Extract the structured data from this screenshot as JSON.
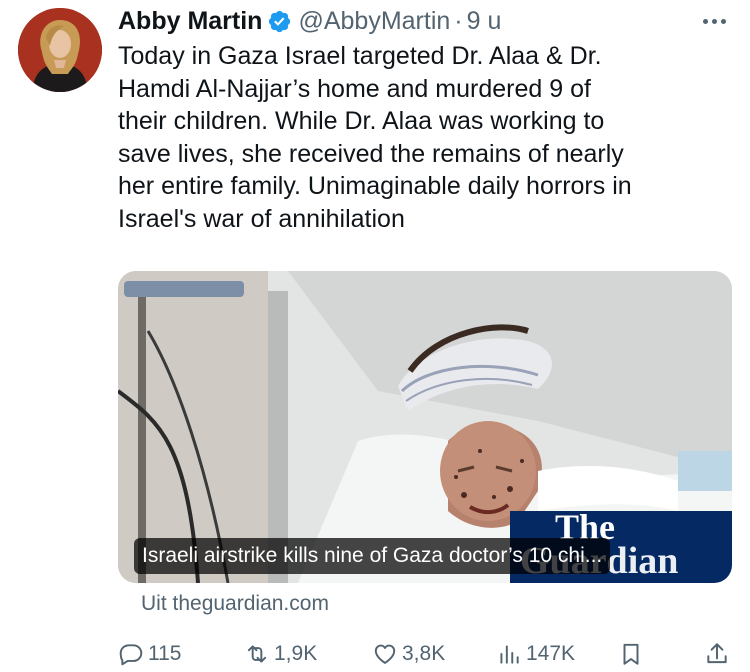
{
  "author": {
    "display_name": "Abby Martin",
    "handle": "@AbbyMartin",
    "separator": "·",
    "time": "9 u",
    "verified": true
  },
  "tweet": {
    "text": "Today in Gaza Israel targeted Dr. Alaa & Dr.\nHamdi Al-Najjar’s home and murdered 9 of\ntheir children. While Dr. Alaa was working to\nsave lives, she received the remains of nearly\nher entire family. Unimaginable daily horrors in\nIsrael's war of annihilation"
  },
  "link_card": {
    "title": "Israeli airstrike kills nine of Gaza doctor’s 10 chi...",
    "logo_line1": "The",
    "logo_line2": "Guardian",
    "source": "Uit theguardian.com"
  },
  "actions": {
    "replies": "115",
    "reposts": "1,9K",
    "likes": "3,8K",
    "views": "147K"
  },
  "icons": {
    "reply": "reply-icon",
    "repost": "repost-icon",
    "like": "heart-icon",
    "views": "views-icon",
    "bookmark": "bookmark-icon",
    "share": "share-icon",
    "more": "more-icon",
    "verified": "verified-badge-icon"
  },
  "colors": {
    "text": "#0f1419",
    "muted": "#536471",
    "verified": "#1d9bf0",
    "guardian": "#052962"
  }
}
